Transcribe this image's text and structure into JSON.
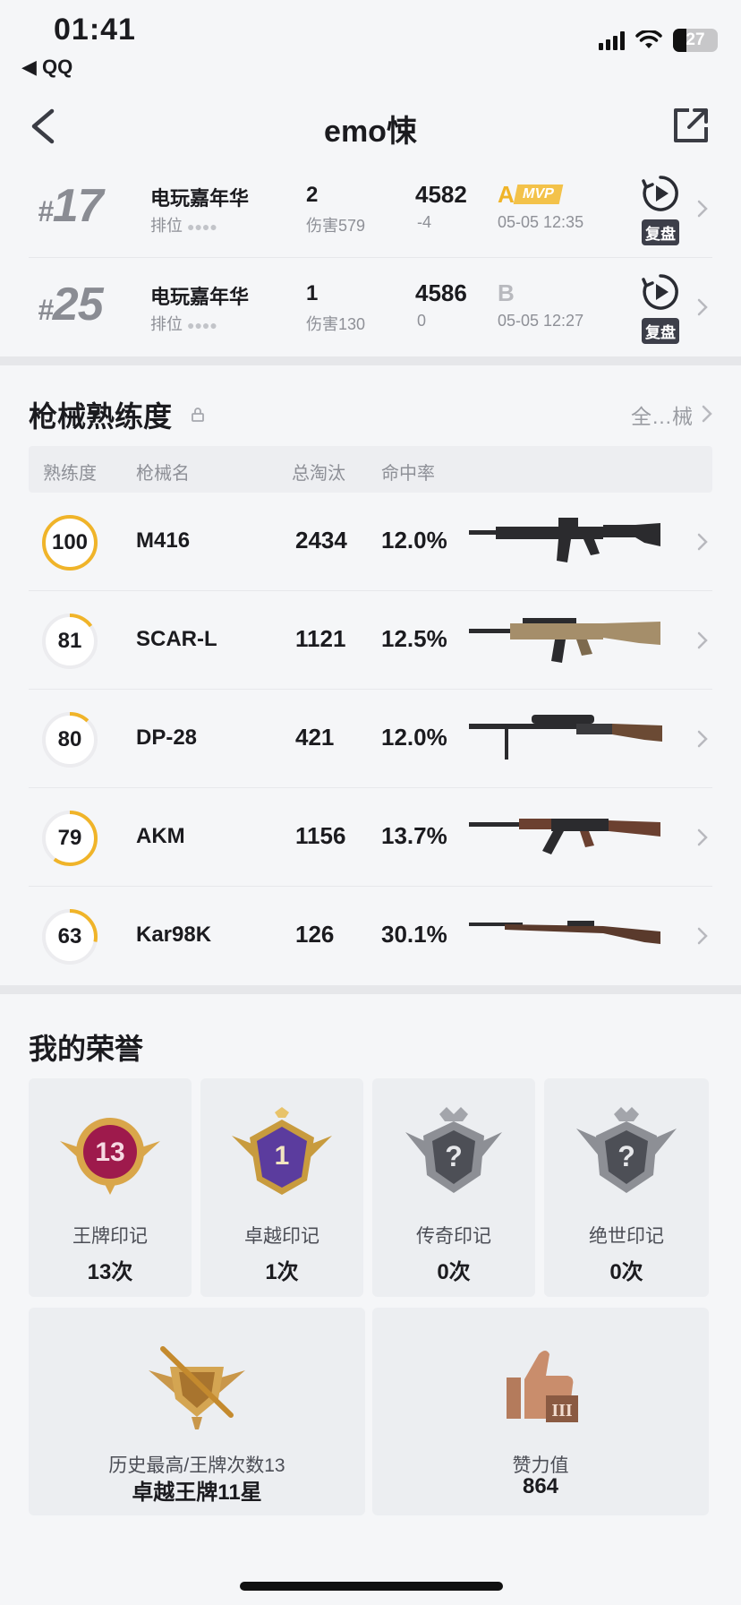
{
  "status": {
    "time": "01:41",
    "back_app": "◀ QQ",
    "battery": "27"
  },
  "header": {
    "title": "emo悚"
  },
  "matches": [
    {
      "rank_hash": "#",
      "rank_num": "17",
      "mode": "电玩嘉年华",
      "mode_sub": "排位",
      "kills": "2",
      "damage": "伤害579",
      "score": "4582",
      "delta": "-4",
      "grade": "A",
      "mvp": "MVP",
      "date": "05-05 12:35",
      "replay": "复盘"
    },
    {
      "rank_hash": "#",
      "rank_num": "25",
      "mode": "电玩嘉年华",
      "mode_sub": "排位",
      "kills": "1",
      "damage": "伤害130",
      "score": "4586",
      "delta": "0",
      "grade": "B",
      "mvp": "",
      "date": "05-05 12:27",
      "replay": "复盘"
    }
  ],
  "weapons": {
    "title": "枪械熟练度",
    "see_all": "全…械",
    "columns": [
      "熟练度",
      "枪械名",
      "总淘汰",
      "命中率"
    ],
    "rows": [
      {
        "mastery": "100",
        "mastery_fraction": 1.0,
        "name": "M416",
        "kills": "2434",
        "accuracy": "12.0%",
        "icon": "m416-rifle-icon"
      },
      {
        "mastery": "81",
        "mastery_fraction": 0.15,
        "name": "SCAR-L",
        "kills": "1121",
        "accuracy": "12.5%",
        "icon": "scar-l-rifle-icon"
      },
      {
        "mastery": "80",
        "mastery_fraction": 0.12,
        "name": "DP-28",
        "kills": "421",
        "accuracy": "12.0%",
        "icon": "dp-28-machine-gun-icon"
      },
      {
        "mastery": "79",
        "mastery_fraction": 0.6,
        "name": "AKM",
        "kills": "1156",
        "accuracy": "13.7%",
        "icon": "akm-rifle-icon"
      },
      {
        "mastery": "63",
        "mastery_fraction": 0.28,
        "name": "Kar98K",
        "kills": "126",
        "accuracy": "30.1%",
        "icon": "kar98k-rifle-icon"
      }
    ]
  },
  "honors": {
    "title": "我的荣誉",
    "marks": [
      {
        "label": "王牌印记",
        "count": "13次",
        "badge_text": "13"
      },
      {
        "label": "卓越印记",
        "count": "1次",
        "badge_text": "1"
      },
      {
        "label": "传奇印记",
        "count": "0次",
        "badge_text": "?"
      },
      {
        "label": "绝世印记",
        "count": "0次",
        "badge_text": "?"
      }
    ],
    "history": {
      "label": "历史最高/王牌次数13",
      "value": "卓越王牌11星"
    },
    "likes": {
      "label": "赞力值",
      "value": "864",
      "badge_text": "III"
    }
  },
  "colors": {
    "accent": "#f0b429",
    "grade_b": "#b8b9be",
    "page_bg": "#f5f6f8"
  }
}
